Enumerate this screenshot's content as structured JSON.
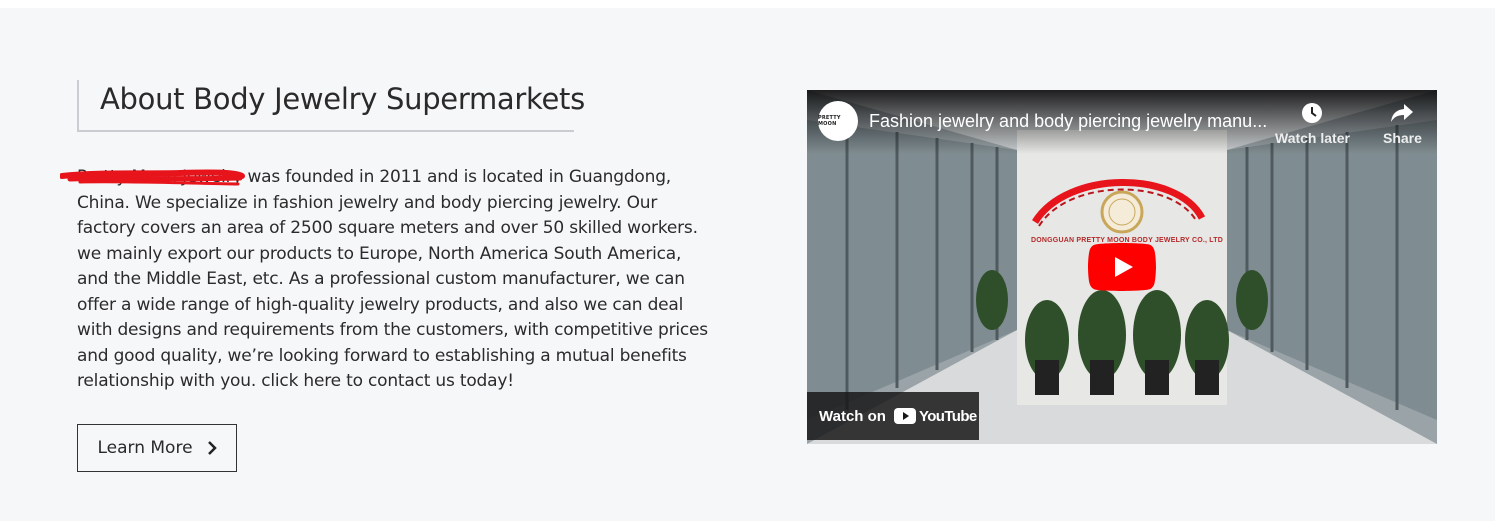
{
  "about": {
    "title": "About Body Jewelry Supermarkets",
    "paragraph": "Pretty Moon Jewelry was founded in 2011 and is located in Guangdong, China. We specialize in fashion jewelry and body piercing jewelry. Our factory covers an area of 2500 square meters and over 50 skilled workers. we mainly export our products to Europe, North America South America, and the Middle East, etc. As a professional custom manufacturer, we can offer a wide range of high-quality jewelry products, and also we can deal with designs and requirements from the customers, with competitive prices and good quality, we’re looking forward to establishing a mutual benefits relationship with you. click here to contact us today!",
    "button_label": "Learn More"
  },
  "video": {
    "title": "Fashion jewelry and body piercing jewelry manu...",
    "channel_avatar_text": "PRETTY MOON",
    "watch_later_label": "Watch later",
    "share_label": "Share",
    "watch_on_label": "Watch on",
    "youtube_label": "YouTube",
    "sign_text": "DONGGUAN PRETTY MOON BODY JEWELRY CO., LTD"
  },
  "colors": {
    "section_bg": "#f6f7f9",
    "play_red": "#ff0000",
    "redaction_red": "#e8141b"
  },
  "icons": [
    "chevron-right-icon",
    "clock-icon",
    "share-arrow-icon",
    "play-icon",
    "youtube-logo-icon"
  ]
}
